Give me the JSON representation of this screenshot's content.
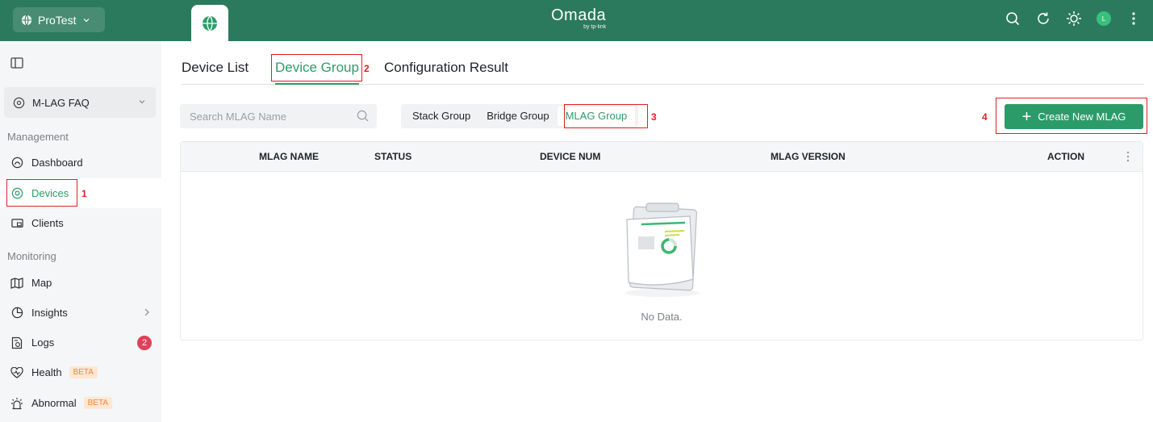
{
  "topbar": {
    "site_selector": "ProTest",
    "logo": "Omada",
    "logo_sub": "by tp-link",
    "avatar_initial": "L",
    "icons": [
      "search-icon",
      "refresh-icon",
      "theme-icon",
      "avatar",
      "more-vertical-icon"
    ]
  },
  "sidebar": {
    "site": "M-LAG FAQ",
    "sections": {
      "management": "Management",
      "monitoring": "Monitoring"
    },
    "items": [
      {
        "label": "Dashboard",
        "icon": "dashboard-icon"
      },
      {
        "label": "Devices",
        "icon": "devices-icon",
        "active": true
      },
      {
        "label": "Clients",
        "icon": "clients-icon"
      },
      {
        "label": "Map",
        "icon": "map-icon"
      },
      {
        "label": "Insights",
        "icon": "insights-icon"
      },
      {
        "label": "Logs",
        "icon": "logs-icon",
        "badge": "2"
      },
      {
        "label": "Health",
        "icon": "health-icon",
        "tag": "BETA"
      },
      {
        "label": "Abnormal",
        "icon": "abnormal-icon",
        "tag": "BETA"
      }
    ]
  },
  "tabs": [
    "Device List",
    "Device Group",
    "Configuration Result"
  ],
  "toolbar": {
    "search_placeholder": "Search MLAG Name",
    "segments": [
      "Stack Group",
      "Bridge Group",
      "MLAG Group"
    ],
    "create_label": "Create New MLAG"
  },
  "table": {
    "columns": [
      "MLAG NAME",
      "STATUS",
      "DEVICE NUM",
      "MLAG VERSION",
      "ACTION"
    ],
    "empty_text": "No Data."
  },
  "annotations": [
    "1",
    "2",
    "3",
    "4"
  ],
  "colors": {
    "brand": "#2c7a5e",
    "accent": "#2c9b6a",
    "annotation": "#e02020"
  }
}
